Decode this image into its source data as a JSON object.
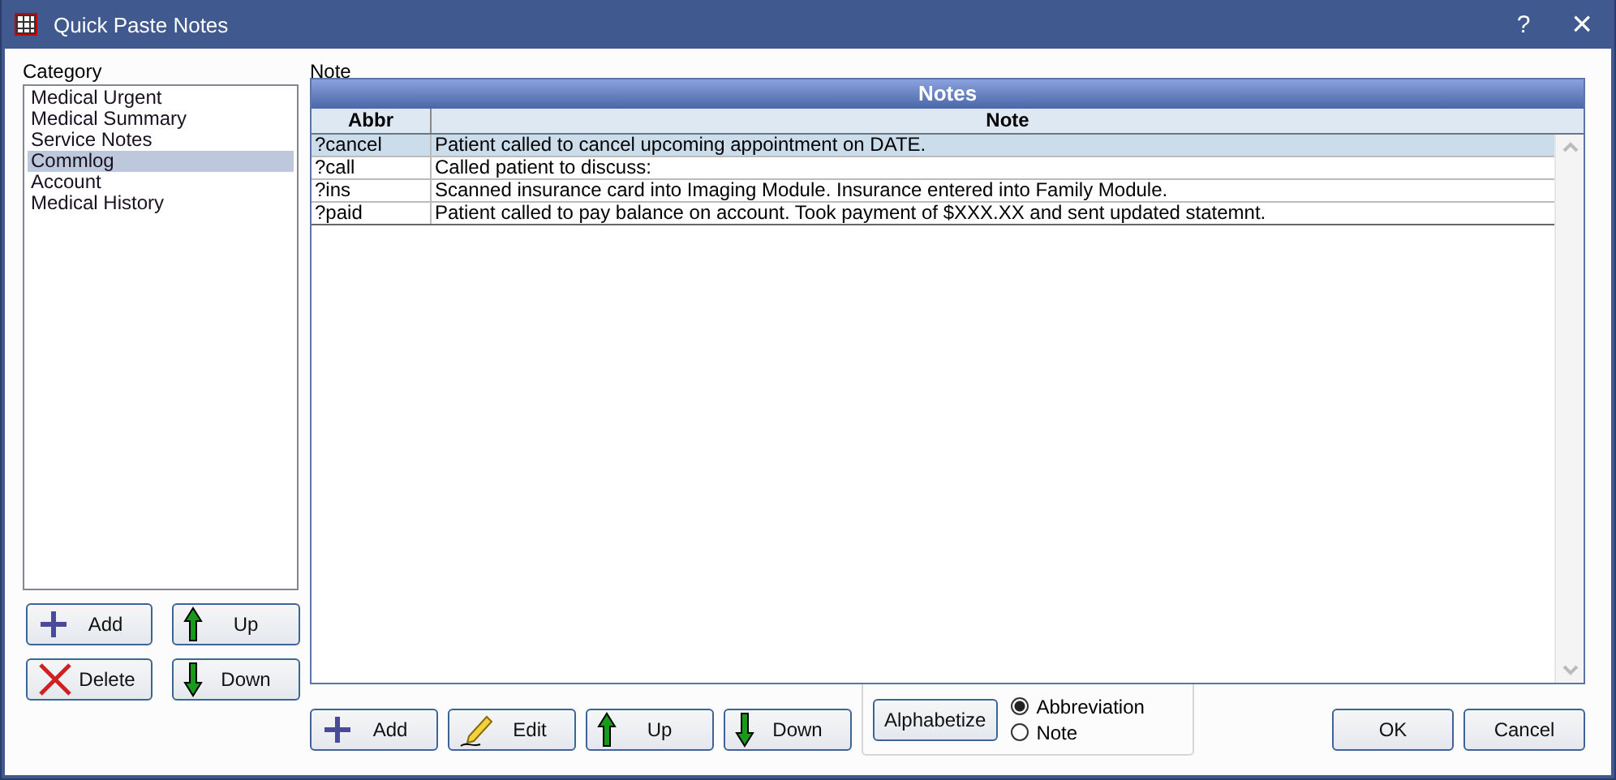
{
  "window": {
    "title": "Quick Paste Notes",
    "help_glyph": "?",
    "close_glyph": "×"
  },
  "category": {
    "label": "Category",
    "items": [
      {
        "label": "Medical Urgent",
        "selected": false
      },
      {
        "label": "Medical Summary",
        "selected": false
      },
      {
        "label": "Service Notes",
        "selected": false
      },
      {
        "label": "Commlog",
        "selected": true
      },
      {
        "label": "Account",
        "selected": false
      },
      {
        "label": "Medical History",
        "selected": false
      }
    ],
    "buttons": [
      {
        "label": "Add",
        "kind": "add"
      },
      {
        "label": "Up",
        "kind": "up"
      },
      {
        "label": "Delete",
        "kind": "delete"
      },
      {
        "label": "Down",
        "kind": "down"
      }
    ]
  },
  "notes": {
    "label": "Note",
    "table": {
      "title": "Notes",
      "columns": [
        "Abbr",
        "Note"
      ],
      "rows": [
        {
          "abbr": "?cancel",
          "note": "Patient called to cancel upcoming appointment on DATE.",
          "selected": true
        },
        {
          "abbr": "?call",
          "note": "Called patient to discuss:",
          "selected": false
        },
        {
          "abbr": "?ins",
          "note": "Scanned insurance card into Imaging Module. Insurance entered into Family Module.",
          "selected": false
        },
        {
          "abbr": "?paid",
          "note": "Patient called to pay balance on account. Took payment of $XXX.XX and sent updated statemnt.",
          "selected": false
        }
      ]
    },
    "buttons": [
      {
        "label": "Add",
        "kind": "add"
      },
      {
        "label": "Edit",
        "kind": "edit"
      },
      {
        "label": "Up",
        "kind": "up"
      },
      {
        "label": "Down",
        "kind": "down"
      }
    ],
    "alphabetize": "Alphabetize",
    "sort_options": [
      {
        "label": "Abbreviation",
        "selected": true
      },
      {
        "label": "Note",
        "selected": false
      }
    ]
  },
  "dialog_buttons": [
    "OK",
    "Cancel"
  ]
}
